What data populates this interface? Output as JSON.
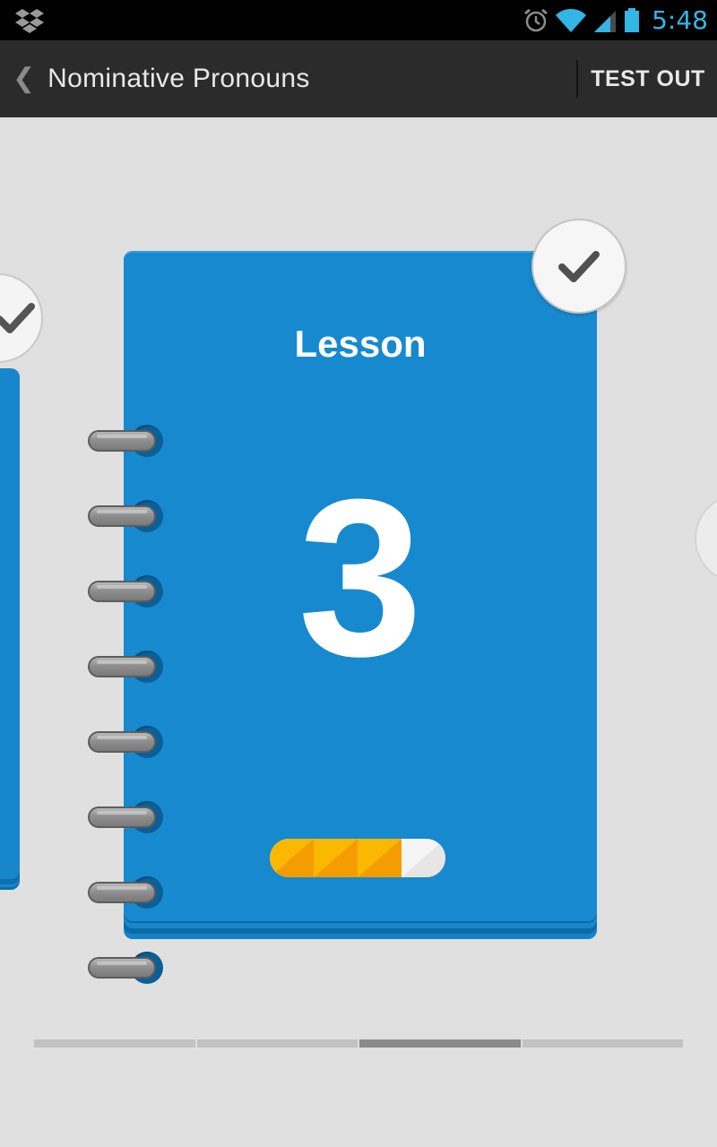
{
  "status_bar": {
    "time": "5:48",
    "time_color": "#33b5e5",
    "icons": [
      "dropbox-icon",
      "alarm-icon",
      "wifi-icon",
      "signal-icon",
      "battery-icon"
    ]
  },
  "action_bar": {
    "back_icon": "chevron-left-icon",
    "title": "Nominative Pronouns",
    "test_out_label": "TEST OUT"
  },
  "lesson_card": {
    "label": "Lesson",
    "number": "3",
    "completed": true,
    "color": "#1789cf",
    "progress": {
      "filled_segments": 3,
      "total_segments": 4,
      "fill_color": "#fbb800"
    }
  },
  "pager": {
    "pages": 4,
    "active_index": 2
  }
}
